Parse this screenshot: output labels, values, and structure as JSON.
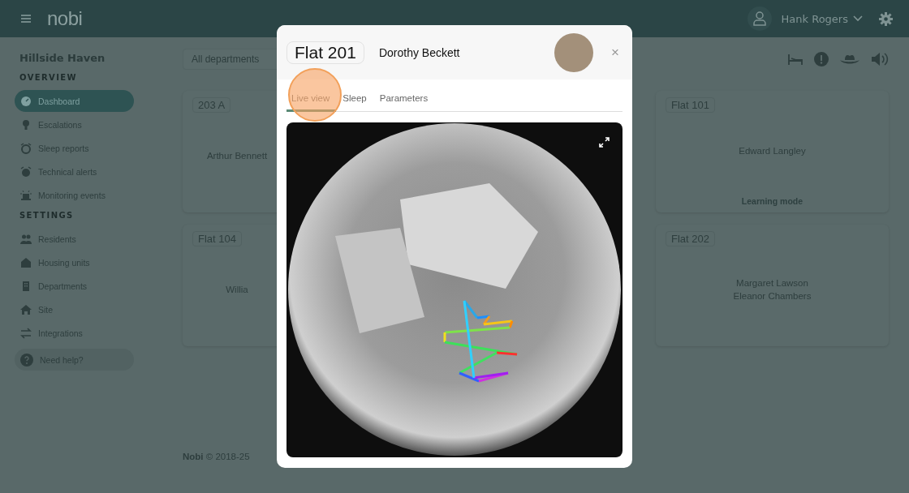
{
  "topbar": {
    "logo": "nobi",
    "user": "Hank Rogers"
  },
  "sidebar": {
    "site": "Hillside Haven",
    "sections": [
      {
        "title": "OVERVIEW",
        "items": [
          {
            "label": "Dashboard",
            "selected": true
          },
          {
            "label": "Escalations",
            "selected": false
          },
          {
            "label": "Sleep reports",
            "selected": false
          },
          {
            "label": "Technical alerts",
            "selected": false
          },
          {
            "label": "Monitoring events",
            "selected": false
          }
        ]
      },
      {
        "title": "SETTINGS",
        "items": [
          {
            "label": "Residents",
            "selected": false
          },
          {
            "label": "Housing units",
            "selected": false
          },
          {
            "label": "Departments",
            "selected": false
          },
          {
            "label": "Site",
            "selected": false
          },
          {
            "label": "Integrations",
            "selected": false
          }
        ]
      }
    ],
    "help": "Need help?"
  },
  "filter": {
    "value": "All departments"
  },
  "cards": [
    {
      "unit": "203 A",
      "residents": [
        "Arthur Bennett"
      ]
    },
    {
      "unit": "Flat 101",
      "residents": [
        "Edward Langley"
      ],
      "status": "Learning mode"
    },
    {
      "unit": "Flat 104",
      "residents": [
        "Willia"
      ]
    },
    {
      "unit": "Flat 202",
      "residents": [
        "Margaret Lawson",
        "Eleanor Chambers"
      ]
    }
  ],
  "footer": "**Nobi** © 2018-25",
  "modal": {
    "unit": "Flat 201",
    "resident": "Dorothy Beckett",
    "close": "×",
    "tabs": [
      {
        "label": "Live view",
        "selected": true
      },
      {
        "label": "Sleep",
        "selected": false
      },
      {
        "label": "Parameters",
        "selected": false
      }
    ]
  }
}
